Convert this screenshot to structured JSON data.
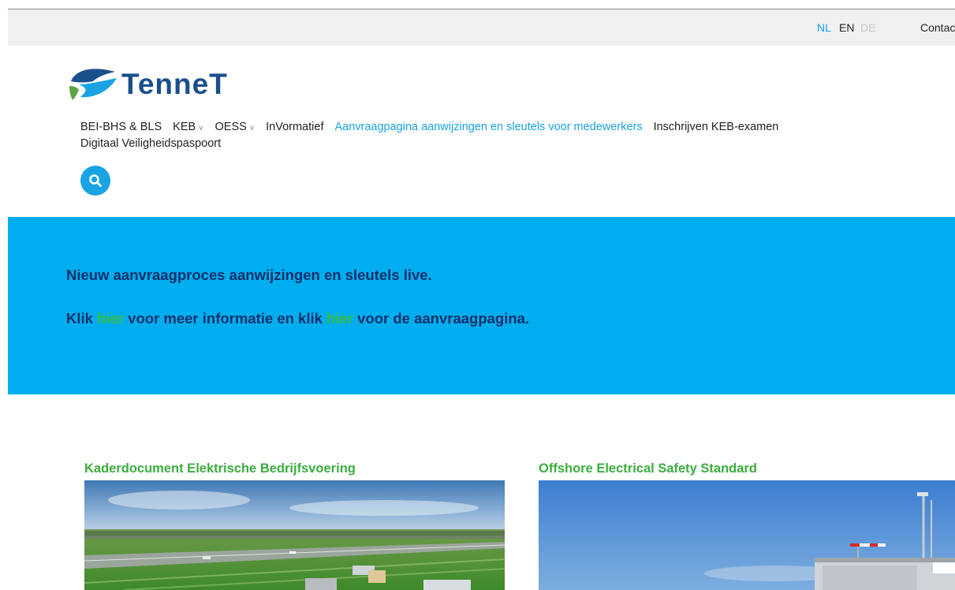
{
  "topbar": {
    "languages": [
      {
        "code": "NL",
        "state": "active",
        "color": "#1aa3e3"
      },
      {
        "code": "EN",
        "state": "default",
        "color": "#222222"
      },
      {
        "code": "DE",
        "state": "disabled",
        "color": "#c5c8cb"
      }
    ],
    "contact": "Contact"
  },
  "logo": {
    "text": "TenneT",
    "icon": "tennet-swoosh-logo"
  },
  "nav": {
    "items": [
      {
        "label": "BEI-BHS & BLS",
        "has_dropdown": false
      },
      {
        "label": "KEB",
        "has_dropdown": true
      },
      {
        "label": "OESS",
        "has_dropdown": true
      },
      {
        "label": "InVormatief",
        "has_dropdown": false
      },
      {
        "label": "Aanvraagpagina aanwijzingen en sleutels voor medewerkers",
        "has_dropdown": false,
        "active": true
      },
      {
        "label": "Inschrijven KEB-examen",
        "has_dropdown": false
      },
      {
        "label": "Digitaal Veiligheidspaspoort",
        "has_dropdown": false
      }
    ],
    "search_icon": "search-icon"
  },
  "banner": {
    "line1": "Nieuw aanvraagproces aanwijzingen en sleutels live.",
    "line2_part1": "Klik ",
    "link1": "hier",
    "line2_part2": " voor meer informatie en klik ",
    "link2": "hier",
    "line2_part3": " voor de aanvraagpagina."
  },
  "cards": [
    {
      "title": "Kaderdocument Elektrische Bedrijfsvoering",
      "image": "aerial-landscape-highway-photo"
    },
    {
      "title": "Offshore Electrical Safety Standard",
      "image": "offshore-platform-photo"
    }
  ],
  "colors": {
    "accent": "#1aa3e3",
    "banner_bg": "#00aeef",
    "banner_text": "#10306b",
    "link_green": "#3dbb3a",
    "card_title_green": "#3bae3e",
    "logo_blue": "#1a4f8b",
    "topbar_bg": "#eef0f1"
  }
}
